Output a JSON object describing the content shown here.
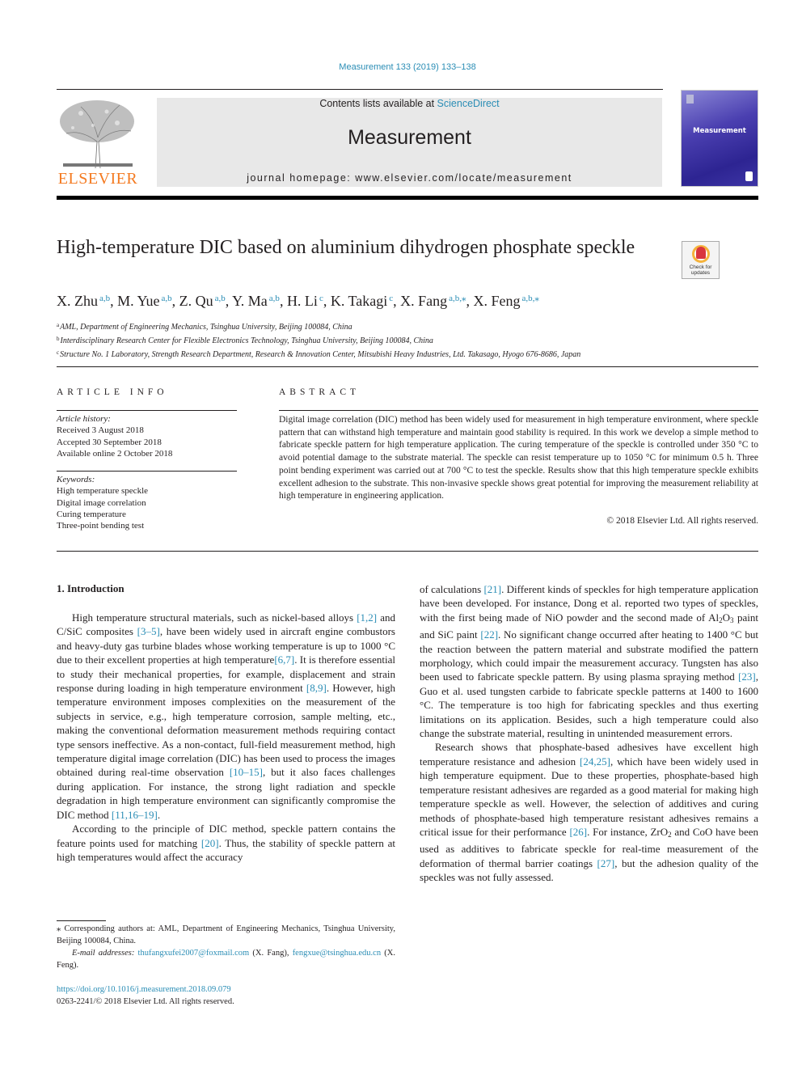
{
  "journal_ref": "Measurement 133 (2019) 133–138",
  "masthead": {
    "contents_prefix": "Contents lists available at ",
    "contents_link": "ScienceDirect",
    "journal_name": "Measurement",
    "homepage": "journal homepage: www.elsevier.com/locate/measurement",
    "publisher_logo": "ELSEVIER",
    "cover_title": "Measurement"
  },
  "crossmark": {
    "label_line1": "Check for",
    "label_line2": "updates"
  },
  "article": {
    "title": "High-temperature DIC based on aluminium dihydrogen phosphate speckle",
    "authors": [
      {
        "name": "X. Zhu",
        "sup": "a,b"
      },
      {
        "name": "M. Yue",
        "sup": "a,b"
      },
      {
        "name": "Z. Qu",
        "sup": "a,b"
      },
      {
        "name": "Y. Ma",
        "sup": "a,b"
      },
      {
        "name": "H. Li",
        "sup": "c"
      },
      {
        "name": "K. Takagi",
        "sup": "c"
      },
      {
        "name": "X. Fang",
        "sup": "a,b,⁎"
      },
      {
        "name": "X. Feng",
        "sup": "a,b,⁎"
      }
    ],
    "affiliations": [
      {
        "key": "a",
        "text": "AML, Department of Engineering Mechanics, Tsinghua University, Beijing 100084, China"
      },
      {
        "key": "b",
        "text": "Interdisciplinary Research Center for Flexible Electronics Technology, Tsinghua University, Beijing 100084, China"
      },
      {
        "key": "c",
        "text": "Structure No. 1 Laboratory, Strength Research Department, Research & Innovation Center, Mitsubishi Heavy Industries, Ltd. Takasago, Hyogo 676-8686, Japan"
      }
    ]
  },
  "article_info": {
    "heading": "ARTICLE INFO",
    "history_label": "Article history:",
    "history": [
      "Received 3 August 2018",
      "Accepted 30 September 2018",
      "Available online 2 October 2018"
    ],
    "keywords_label": "Keywords:",
    "keywords": [
      "High temperature speckle",
      "Digital image correlation",
      "Curing temperature",
      "Three-point bending test"
    ]
  },
  "abstract": {
    "heading": "ABSTRACT",
    "text": "Digital image correlation (DIC) method has been widely used for measurement in high temperature environment, where speckle pattern that can withstand high temperature and maintain good stability is required. In this work we develop a simple method to fabricate speckle pattern for high temperature application. The curing temperature of the speckle is controlled under 350 °C to avoid potential damage to the substrate material. The speckle can resist temperature up to 1050 °C for minimum 0.5 h. Three point bending experiment was carried out at 700 °C to test the speckle. Results show that this high temperature speckle exhibits excellent adhesion to the substrate. This non-invasive speckle shows great potential for improving the measurement reliability at high temperature in engineering application.",
    "copyright": "© 2018 Elsevier Ltd. All rights reserved."
  },
  "intro": {
    "heading": "1. Introduction",
    "left_paragraphs": [
      [
        {
          "t": "High temperature structural materials, such as nickel-based alloys "
        },
        {
          "ref": "[1,2]"
        },
        {
          "t": " and C/SiC composites "
        },
        {
          "ref": "[3–5]"
        },
        {
          "t": ", have been widely used in aircraft engine combustors and heavy-duty gas turbine blades whose working temperature is up to 1000 °C due to their excellent properties at high temperature"
        },
        {
          "ref": "[6,7]"
        },
        {
          "t": ". It is therefore essential to study their mechanical properties, for example, displacement and strain response during loading in high temperature environment "
        },
        {
          "ref": "[8,9]"
        },
        {
          "t": ". However, high temperature environment imposes complexities on the measurement of the subjects in service, e.g., high temperature corrosion, sample melting, etc., making the conventional deformation measurement methods requiring contact type sensors ineffective. As a non-contact, full-field measurement method, high temperature digital image correlation (DIC) has been used to process the images obtained during real-time observation "
        },
        {
          "ref": "[10–15]"
        },
        {
          "t": ", but it also faces challenges during application. For instance, the strong light radiation and speckle degradation in high temperature environment can significantly compromise the DIC method "
        },
        {
          "ref": "[11,16–19]"
        },
        {
          "t": "."
        }
      ],
      [
        {
          "t": "According to the principle of DIC method, speckle pattern contains the feature points used for matching "
        },
        {
          "ref": "[20]"
        },
        {
          "t": ". Thus, the stability of speckle pattern at high temperatures would affect the accuracy"
        }
      ]
    ],
    "right_paragraphs": [
      [
        {
          "t": "of calculations "
        },
        {
          "ref": "[21]"
        },
        {
          "t": ". Different kinds of speckles for high temperature application have been developed. For instance, Dong et al. reported two types of speckles, with the first being made of NiO powder and the second made of Al"
        },
        {
          "sub": "2"
        },
        {
          "t": "O"
        },
        {
          "sub": "3"
        },
        {
          "t": " paint and SiC paint "
        },
        {
          "ref": "[22]"
        },
        {
          "t": ". No significant change occurred after heating to 1400 °C but the reaction between the pattern material and substrate modified the pattern morphology, which could impair the measurement accuracy. Tungsten has also been used to fabricate speckle pattern. By using plasma spraying method "
        },
        {
          "ref": "[23]"
        },
        {
          "t": ", Guo et al. used tungsten carbide to fabricate speckle patterns at 1400 to 1600 °C. The temperature is too high for fabricating speckles and thus exerting limitations on its application. Besides, such a high temperature could also change the substrate material, resulting in unintended measurement errors."
        }
      ],
      [
        {
          "t": "Research shows that phosphate-based adhesives have excellent high temperature resistance and adhesion "
        },
        {
          "ref": "[24,25]"
        },
        {
          "t": ", which have been widely used in high temperature equipment. Due to these properties, phosphate-based high temperature resistant adhesives are regarded as a good material for making high temperature speckle as well. However, the selection of additives and curing methods of phosphate-based high temperature resistant adhesives remains a critical issue for their performance "
        },
        {
          "ref": "[26]"
        },
        {
          "t": ". For instance, ZrO"
        },
        {
          "sub": "2"
        },
        {
          "t": " and CoO have been used as additives to fabricate speckle for real-time measurement of the deformation of thermal barrier coatings "
        },
        {
          "ref": "[27]"
        },
        {
          "t": ", but the adhesion quality of the speckles was not fully assessed."
        }
      ]
    ]
  },
  "footnotes": {
    "corresponding": "⁎ Corresponding authors at: AML, Department of Engineering Mechanics, Tsinghua University, Beijing 100084, China.",
    "email_label": "E-mail addresses:",
    "email1": "thufangxufei2007@foxmail.com",
    "email1_owner": " (X. Fang), ",
    "email2": "fengxue@tsinghua.edu.cn",
    "email2_owner": " (X. Feng)."
  },
  "doi": "https://doi.org/10.1016/j.measurement.2018.09.079",
  "issn_line": "0263-2241/© 2018 Elsevier Ltd. All rights reserved.",
  "colors": {
    "link": "#2a8db5",
    "elsevier_orange": "#f47a20",
    "masthead_bg": "#e8e8e8",
    "cover_blue": "#3d35a5"
  }
}
